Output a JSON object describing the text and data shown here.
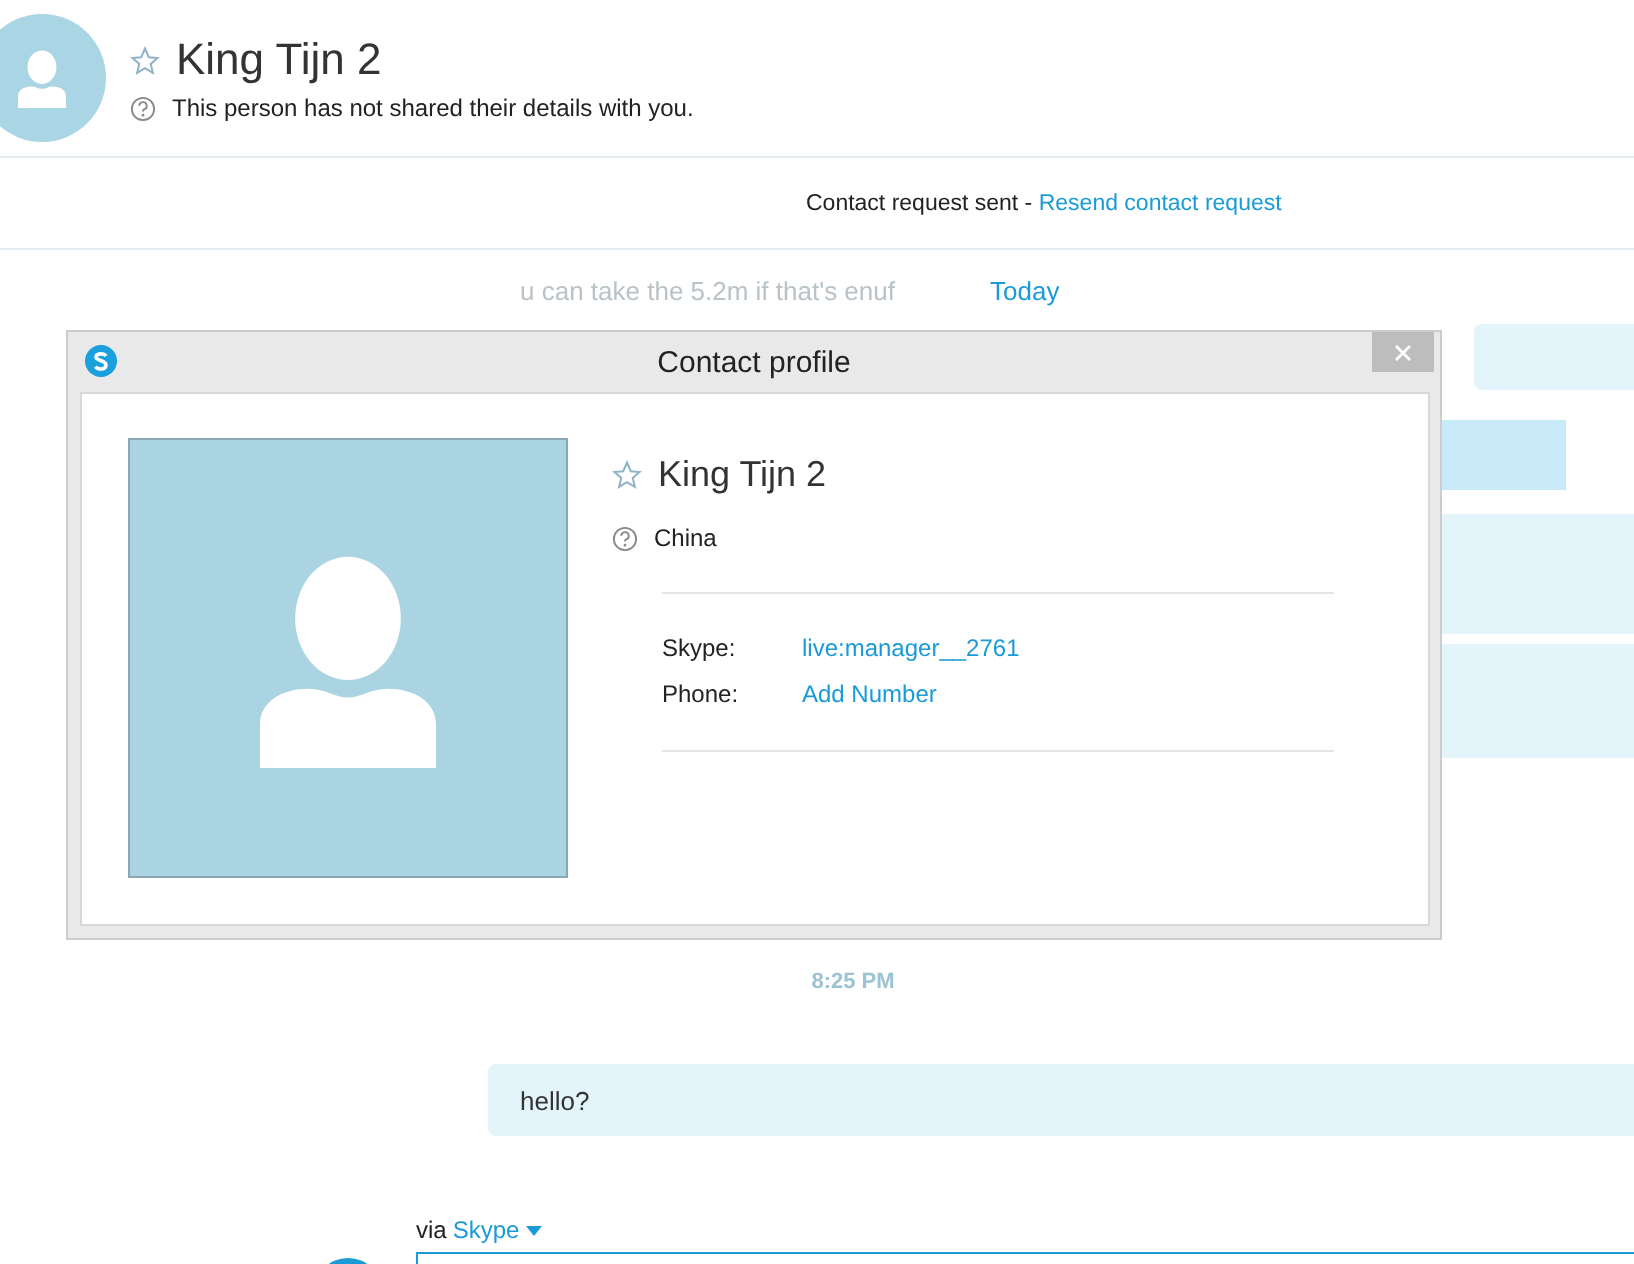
{
  "header": {
    "name": "King Tijn 2",
    "subtitle": "This person has not shared their details with you.",
    "starred": false
  },
  "request_bar": {
    "text": "Contact request sent - ",
    "link": "Resend contact request"
  },
  "chat": {
    "faded_message": "u can take the 5.2m if that's enuf",
    "day_label": "Today",
    "time_label": "8:25 PM",
    "messages": [
      {
        "text": "hello?"
      }
    ]
  },
  "compose": {
    "via": "via",
    "network": "Skype"
  },
  "dialog": {
    "title": "Contact profile",
    "name": "King Tijn 2",
    "starred": false,
    "location": "China",
    "fields": [
      {
        "label": "Skype:",
        "value": "live:manager__2761"
      },
      {
        "label": "Phone:",
        "value": "Add Number"
      }
    ]
  }
}
